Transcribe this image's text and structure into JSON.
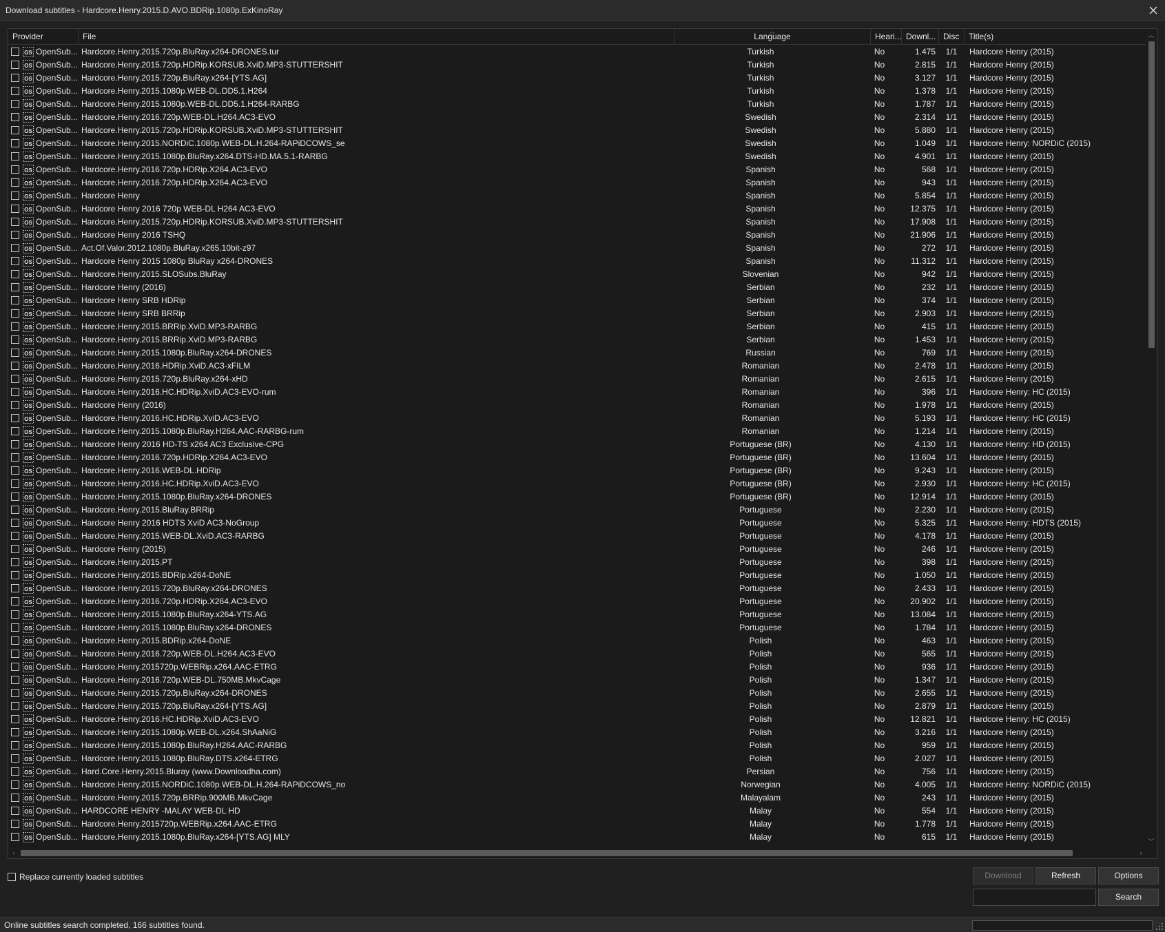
{
  "window": {
    "title": "Download subtitles - Hardcore.Henry.2015.D.AVO.BDRip.1080p.ExKinoRay"
  },
  "columns": {
    "provider": "Provider",
    "file": "File",
    "language": "Language",
    "hearing": "Heari...",
    "downloads": "Downl...",
    "disc": "Disc",
    "titles": "Title(s)"
  },
  "sort": {
    "column": "language",
    "direction": "descending"
  },
  "rows": [
    {
      "provider": "OpenSub...",
      "file": "Hardcore.Henry.2015.720p.BluRay.x264-DRONES.tur",
      "language": "Turkish",
      "hearing": "No",
      "downloads": "1.475",
      "disc": "1/1",
      "title": "Hardcore Henry (2015)"
    },
    {
      "provider": "OpenSub...",
      "file": "Hardcore.Henry.2015.720p.HDRip.KORSUB.XviD.MP3-STUTTERSHIT",
      "language": "Turkish",
      "hearing": "No",
      "downloads": "2.815",
      "disc": "1/1",
      "title": "Hardcore Henry (2015)"
    },
    {
      "provider": "OpenSub...",
      "file": "Hardcore.Henry.2015.720p.BluRay.x264-[YTS.AG]",
      "language": "Turkish",
      "hearing": "No",
      "downloads": "3.127",
      "disc": "1/1",
      "title": "Hardcore Henry (2015)"
    },
    {
      "provider": "OpenSub...",
      "file": "Hardcore.Henry.2015.1080p.WEB-DL.DD5.1.H264",
      "language": "Turkish",
      "hearing": "No",
      "downloads": "1.378",
      "disc": "1/1",
      "title": "Hardcore Henry (2015)"
    },
    {
      "provider": "OpenSub...",
      "file": "Hardcore.Henry.2015.1080p.WEB-DL.DD5.1.H264-RARBG",
      "language": "Turkish",
      "hearing": "No",
      "downloads": "1.787",
      "disc": "1/1",
      "title": "Hardcore Henry (2015)"
    },
    {
      "provider": "OpenSub...",
      "file": "Hardcore.Henry.2016.720p.WEB-DL.H264.AC3-EVO",
      "language": "Swedish",
      "hearing": "No",
      "downloads": "2.314",
      "disc": "1/1",
      "title": "Hardcore Henry (2015)"
    },
    {
      "provider": "OpenSub...",
      "file": "Hardcore.Henry.2015.720p.HDRip.KORSUB.XviD.MP3-STUTTERSHIT",
      "language": "Swedish",
      "hearing": "No",
      "downloads": "5.880",
      "disc": "1/1",
      "title": "Hardcore Henry (2015)"
    },
    {
      "provider": "OpenSub...",
      "file": "Hardcore.Henry.2015.NORDiC.1080p.WEB-DL.H.264-RAPiDCOWS_se",
      "language": "Swedish",
      "hearing": "No",
      "downloads": "1.049",
      "disc": "1/1",
      "title": "Hardcore Henry: NORDiC (2015)"
    },
    {
      "provider": "OpenSub...",
      "file": "Hardcore.Henry.2015.1080p.BluRay.x264.DTS-HD.MA.5.1-RARBG",
      "language": "Swedish",
      "hearing": "No",
      "downloads": "4.901",
      "disc": "1/1",
      "title": "Hardcore Henry (2015)"
    },
    {
      "provider": "OpenSub...",
      "file": "Hardcore.Henry.2016.720p.HDRip.X264.AC3-EVO",
      "language": "Spanish",
      "hearing": "No",
      "downloads": "568",
      "disc": "1/1",
      "title": "Hardcore Henry (2015)"
    },
    {
      "provider": "OpenSub...",
      "file": "Hardcore.Henry.2016.720p.HDRip.X264.AC3-EVO",
      "language": "Spanish",
      "hearing": "No",
      "downloads": "943",
      "disc": "1/1",
      "title": "Hardcore Henry (2015)"
    },
    {
      "provider": "OpenSub...",
      "file": "Hardcore Henry",
      "language": "Spanish",
      "hearing": "No",
      "downloads": "5.854",
      "disc": "1/1",
      "title": "Hardcore Henry (2015)"
    },
    {
      "provider": "OpenSub...",
      "file": "Hardcore Henry 2016 720p WEB-DL H264 AC3-EVO",
      "language": "Spanish",
      "hearing": "No",
      "downloads": "12.375",
      "disc": "1/1",
      "title": "Hardcore Henry (2015)"
    },
    {
      "provider": "OpenSub...",
      "file": "Hardcore.Henry.2015.720p.HDRip.KORSUB.XviD.MP3-STUTTERSHIT",
      "language": "Spanish",
      "hearing": "No",
      "downloads": "17.908",
      "disc": "1/1",
      "title": "Hardcore Henry (2015)"
    },
    {
      "provider": "OpenSub...",
      "file": "Hardcore Henry 2016 TSHQ",
      "language": "Spanish",
      "hearing": "No",
      "downloads": "21.906",
      "disc": "1/1",
      "title": "Hardcore Henry (2015)"
    },
    {
      "provider": "OpenSub...",
      "file": "Act.Of.Valor.2012.1080p.BluRay.x265.10bit-z97",
      "language": "Spanish",
      "hearing": "No",
      "downloads": "272",
      "disc": "1/1",
      "title": "Hardcore Henry (2015)"
    },
    {
      "provider": "OpenSub...",
      "file": "Hardcore Henry 2015 1080p BluRay x264-DRONES",
      "language": "Spanish",
      "hearing": "No",
      "downloads": "11.312",
      "disc": "1/1",
      "title": "Hardcore Henry (2015)"
    },
    {
      "provider": "OpenSub...",
      "file": "Hardcore.Henry.2015.SLOSubs.BluRay",
      "language": "Slovenian",
      "hearing": "No",
      "downloads": "942",
      "disc": "1/1",
      "title": "Hardcore Henry (2015)"
    },
    {
      "provider": "OpenSub...",
      "file": "Hardcore Henry (2016)",
      "language": "Serbian",
      "hearing": "No",
      "downloads": "232",
      "disc": "1/1",
      "title": "Hardcore Henry (2015)"
    },
    {
      "provider": "OpenSub...",
      "file": "Hardcore Henry SRB HDRip",
      "language": "Serbian",
      "hearing": "No",
      "downloads": "374",
      "disc": "1/1",
      "title": "Hardcore Henry (2015)"
    },
    {
      "provider": "OpenSub...",
      "file": "Hardcore Henry SRB BRRip",
      "language": "Serbian",
      "hearing": "No",
      "downloads": "2.903",
      "disc": "1/1",
      "title": "Hardcore Henry (2015)"
    },
    {
      "provider": "OpenSub...",
      "file": "Hardcore.Henry.2015.BRRip.XviD.MP3-RARBG",
      "language": "Serbian",
      "hearing": "No",
      "downloads": "415",
      "disc": "1/1",
      "title": "Hardcore Henry (2015)"
    },
    {
      "provider": "OpenSub...",
      "file": "Hardcore.Henry.2015.BRRip.XviD.MP3-RARBG",
      "language": "Serbian",
      "hearing": "No",
      "downloads": "1.453",
      "disc": "1/1",
      "title": "Hardcore Henry (2015)"
    },
    {
      "provider": "OpenSub...",
      "file": "Hardcore.Henry.2015.1080p.BluRay.x264-DRONES",
      "language": "Russian",
      "hearing": "No",
      "downloads": "769",
      "disc": "1/1",
      "title": "Hardcore Henry (2015)"
    },
    {
      "provider": "OpenSub...",
      "file": "Hardcore.Henry.2016.HDRip.XviD.AC3-xFILM",
      "language": "Romanian",
      "hearing": "No",
      "downloads": "2.478",
      "disc": "1/1",
      "title": "Hardcore Henry (2015)"
    },
    {
      "provider": "OpenSub...",
      "file": "Hardcore.Henry.2015.720p.BluRay.x264-xHD",
      "language": "Romanian",
      "hearing": "No",
      "downloads": "2.615",
      "disc": "1/1",
      "title": "Hardcore Henry (2015)"
    },
    {
      "provider": "OpenSub...",
      "file": "Hardcore.Henry.2016.HC.HDRip.XviD.AC3-EVO-rum",
      "language": "Romanian",
      "hearing": "No",
      "downloads": "396",
      "disc": "1/1",
      "title": "Hardcore Henry: HC (2015)"
    },
    {
      "provider": "OpenSub...",
      "file": "Hardcore Henry (2016)",
      "language": "Romanian",
      "hearing": "No",
      "downloads": "1.978",
      "disc": "1/1",
      "title": "Hardcore Henry (2015)"
    },
    {
      "provider": "OpenSub...",
      "file": "Hardcore.Henry.2016.HC.HDRip.XviD.AC3-EVO",
      "language": "Romanian",
      "hearing": "No",
      "downloads": "5.193",
      "disc": "1/1",
      "title": "Hardcore Henry: HC (2015)"
    },
    {
      "provider": "OpenSub...",
      "file": "Hardcore.Henry.2015.1080p.BluRay.H264.AAC-RARBG-rum",
      "language": "Romanian",
      "hearing": "No",
      "downloads": "1.214",
      "disc": "1/1",
      "title": "Hardcore Henry (2015)"
    },
    {
      "provider": "OpenSub...",
      "file": "Hardcore Henry 2016 HD-TS x264 AC3 Exclusive-CPG",
      "language": "Portuguese (BR)",
      "hearing": "No",
      "downloads": "4.130",
      "disc": "1/1",
      "title": "Hardcore Henry: HD (2015)"
    },
    {
      "provider": "OpenSub...",
      "file": "Hardcore.Henry.2016.720p.HDRip.X264.AC3-EVO",
      "language": "Portuguese (BR)",
      "hearing": "No",
      "downloads": "13.604",
      "disc": "1/1",
      "title": "Hardcore Henry (2015)"
    },
    {
      "provider": "OpenSub...",
      "file": "Hardcore.Henry.2016.WEB-DL.HDRip",
      "language": "Portuguese (BR)",
      "hearing": "No",
      "downloads": "9.243",
      "disc": "1/1",
      "title": "Hardcore Henry (2015)"
    },
    {
      "provider": "OpenSub...",
      "file": "Hardcore.Henry.2016.HC.HDRip.XviD.AC3-EVO",
      "language": "Portuguese (BR)",
      "hearing": "No",
      "downloads": "2.930",
      "disc": "1/1",
      "title": "Hardcore Henry: HC (2015)"
    },
    {
      "provider": "OpenSub...",
      "file": "Hardcore.Henry.2015.1080p.BluRay.x264-DRONES",
      "language": "Portuguese (BR)",
      "hearing": "No",
      "downloads": "12.914",
      "disc": "1/1",
      "title": "Hardcore Henry (2015)"
    },
    {
      "provider": "OpenSub...",
      "file": "Hardcore.Henry.2015.BluRay.BRRip",
      "language": "Portuguese",
      "hearing": "No",
      "downloads": "2.230",
      "disc": "1/1",
      "title": "Hardcore Henry (2015)"
    },
    {
      "provider": "OpenSub...",
      "file": "Hardcore Henry 2016 HDTS XviD AC3-NoGroup",
      "language": "Portuguese",
      "hearing": "No",
      "downloads": "5.325",
      "disc": "1/1",
      "title": "Hardcore Henry: HDTS (2015)"
    },
    {
      "provider": "OpenSub...",
      "file": "Hardcore.Henry.2015.WEB-DL.XviD.AC3-RARBG",
      "language": "Portuguese",
      "hearing": "No",
      "downloads": "4.178",
      "disc": "1/1",
      "title": "Hardcore Henry (2015)"
    },
    {
      "provider": "OpenSub...",
      "file": "Hardcore Henry (2015)",
      "language": "Portuguese",
      "hearing": "No",
      "downloads": "246",
      "disc": "1/1",
      "title": "Hardcore Henry (2015)"
    },
    {
      "provider": "OpenSub...",
      "file": "Hardcore.Henry.2015.PT",
      "language": "Portuguese",
      "hearing": "No",
      "downloads": "398",
      "disc": "1/1",
      "title": "Hardcore Henry (2015)"
    },
    {
      "provider": "OpenSub...",
      "file": "Hardcore.Henry.2015.BDRip.x264-DoNE",
      "language": "Portuguese",
      "hearing": "No",
      "downloads": "1.050",
      "disc": "1/1",
      "title": "Hardcore Henry (2015)"
    },
    {
      "provider": "OpenSub...",
      "file": "Hardcore.Henry.2015.720p.BluRay.x264-DRONES",
      "language": "Portuguese",
      "hearing": "No",
      "downloads": "2.433",
      "disc": "1/1",
      "title": "Hardcore Henry (2015)"
    },
    {
      "provider": "OpenSub...",
      "file": "Hardcore.Henry.2016.720p.HDRip.X264.AC3-EVO",
      "language": "Portuguese",
      "hearing": "No",
      "downloads": "20.902",
      "disc": "1/1",
      "title": "Hardcore Henry (2015)"
    },
    {
      "provider": "OpenSub...",
      "file": "Hardcore.Henry.2015.1080p.BluRay.x264-YTS.AG",
      "language": "Portuguese",
      "hearing": "No",
      "downloads": "13.084",
      "disc": "1/1",
      "title": "Hardcore Henry (2015)"
    },
    {
      "provider": "OpenSub...",
      "file": "Hardcore.Henry.2015.1080p.BluRay.x264-DRONES",
      "language": "Portuguese",
      "hearing": "No",
      "downloads": "1.784",
      "disc": "1/1",
      "title": "Hardcore Henry (2015)"
    },
    {
      "provider": "OpenSub...",
      "file": "Hardcore.Henry.2015.BDRip.x264-DoNE",
      "language": "Polish",
      "hearing": "No",
      "downloads": "463",
      "disc": "1/1",
      "title": "Hardcore Henry (2015)"
    },
    {
      "provider": "OpenSub...",
      "file": "Hardcore.Henry.2016.720p.WEB-DL.H264.AC3-EVO",
      "language": "Polish",
      "hearing": "No",
      "downloads": "565",
      "disc": "1/1",
      "title": "Hardcore Henry (2015)"
    },
    {
      "provider": "OpenSub...",
      "file": "Hardcore.Henry.2015720p.WEBRip.x264.AAC-ETRG",
      "language": "Polish",
      "hearing": "No",
      "downloads": "936",
      "disc": "1/1",
      "title": "Hardcore Henry (2015)"
    },
    {
      "provider": "OpenSub...",
      "file": "Hardcore.Henry.2016.720p.WEB-DL.750MB.MkvCage",
      "language": "Polish",
      "hearing": "No",
      "downloads": "1.347",
      "disc": "1/1",
      "title": "Hardcore Henry (2015)"
    },
    {
      "provider": "OpenSub...",
      "file": "Hardcore.Henry.2015.720p.BluRay.x264-DRONES",
      "language": "Polish",
      "hearing": "No",
      "downloads": "2.655",
      "disc": "1/1",
      "title": "Hardcore Henry (2015)"
    },
    {
      "provider": "OpenSub...",
      "file": "Hardcore.Henry.2015.720p.BluRay.x264-[YTS.AG]",
      "language": "Polish",
      "hearing": "No",
      "downloads": "2.879",
      "disc": "1/1",
      "title": "Hardcore Henry (2015)"
    },
    {
      "provider": "OpenSub...",
      "file": "Hardcore.Henry.2016.HC.HDRip.XviD.AC3-EVO",
      "language": "Polish",
      "hearing": "No",
      "downloads": "12.821",
      "disc": "1/1",
      "title": "Hardcore Henry: HC (2015)"
    },
    {
      "provider": "OpenSub...",
      "file": "Hardcore.Henry.2015.1080p.WEB-DL.x264.ShAaNiG",
      "language": "Polish",
      "hearing": "No",
      "downloads": "3.216",
      "disc": "1/1",
      "title": "Hardcore Henry (2015)"
    },
    {
      "provider": "OpenSub...",
      "file": "Hardcore.Henry.2015.1080p.BluRay.H264.AAC-RARBG",
      "language": "Polish",
      "hearing": "No",
      "downloads": "959",
      "disc": "1/1",
      "title": "Hardcore Henry (2015)"
    },
    {
      "provider": "OpenSub...",
      "file": "Hardcore.Henry.2015.1080p.BluRay.DTS.x264-ETRG",
      "language": "Polish",
      "hearing": "No",
      "downloads": "2.027",
      "disc": "1/1",
      "title": "Hardcore Henry (2015)"
    },
    {
      "provider": "OpenSub...",
      "file": "Hard.Core.Henry.2015.Bluray (www.Downloadha.com)",
      "language": "Persian",
      "hearing": "No",
      "downloads": "756",
      "disc": "1/1",
      "title": "Hardcore Henry (2015)"
    },
    {
      "provider": "OpenSub...",
      "file": "Hardcore.Henry.2015.NORDiC.1080p.WEB-DL.H.264-RAPiDCOWS_no",
      "language": "Norwegian",
      "hearing": "No",
      "downloads": "4.005",
      "disc": "1/1",
      "title": "Hardcore Henry: NORDiC (2015)"
    },
    {
      "provider": "OpenSub...",
      "file": "Hardcore.Henry.2015.720p.BRRip.900MB.MkvCage",
      "language": "Malayalam",
      "hearing": "No",
      "downloads": "243",
      "disc": "1/1",
      "title": "Hardcore Henry (2015)"
    },
    {
      "provider": "OpenSub...",
      "file": "HARDCORE HENRY -MALAY WEB-DL HD",
      "language": "Malay",
      "hearing": "No",
      "downloads": "554",
      "disc": "1/1",
      "title": "Hardcore Henry (2015)"
    },
    {
      "provider": "OpenSub...",
      "file": "Hardcore.Henry.2015720p.WEBRip.x264.AAC-ETRG",
      "language": "Malay",
      "hearing": "No",
      "downloads": "1.778",
      "disc": "1/1",
      "title": "Hardcore Henry (2015)"
    },
    {
      "provider": "OpenSub...",
      "file": "Hardcore.Henry.2015.1080p.BluRay.x264-[YTS.AG] MLY",
      "language": "Malay",
      "hearing": "No",
      "downloads": "615",
      "disc": "1/1",
      "title": "Hardcore Henry (2015)"
    }
  ],
  "options": {
    "replace_label": "Replace currently loaded subtitles",
    "replace_checked": false
  },
  "buttons": {
    "download": "Download",
    "refresh": "Refresh",
    "options": "Options",
    "search": "Search"
  },
  "search": {
    "value": ""
  },
  "status": {
    "text": "Online subtitles search completed, 166 subtitles found.",
    "progress": 0
  },
  "icons": {
    "close": "close-icon",
    "provider": "opensubtitles-icon"
  }
}
